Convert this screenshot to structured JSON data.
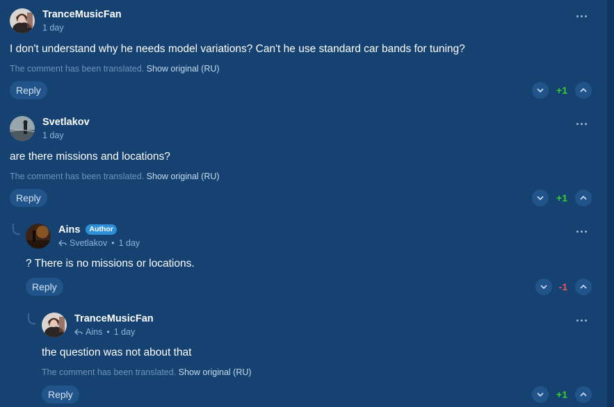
{
  "comments": [
    {
      "author": "TranceMusicFan",
      "time": "1 day",
      "text": "I don't understand why he needs model variations? Can't he use standard car bands for tuning?",
      "translated_note": "The comment has been translated.",
      "show_original": "Show original (RU)",
      "reply_label": "Reply",
      "score": "+1"
    },
    {
      "author": "Svetlakov",
      "time": "1 day",
      "text": "are there missions and locations?",
      "translated_note": "The comment has been translated.",
      "show_original": "Show original (RU)",
      "reply_label": "Reply",
      "score": "+1"
    },
    {
      "author": "Ains",
      "badge": "Author",
      "reply_to": "Svetlakov",
      "time": "1 day",
      "text": "? There is no missions or locations.",
      "reply_label": "Reply",
      "score": "-1"
    },
    {
      "author": "TranceMusicFan",
      "reply_to": "Ains",
      "time": "1 day",
      "text": "the question was not about that",
      "translated_note": "The comment has been translated.",
      "show_original": "Show original (RU)",
      "reply_label": "Reply",
      "score": "+1"
    }
  ],
  "colors": {
    "background": "#164272",
    "button_bg": "#21548b",
    "score_positive": "#34d12a",
    "score_negative": "#e8585a",
    "author_badge": "#2d8fd8"
  },
  "icons": {
    "more": "more-dots-icon",
    "vote_down": "chevron-down-icon",
    "vote_up": "chevron-up-icon",
    "reply_to": "reply-arrow-icon"
  }
}
